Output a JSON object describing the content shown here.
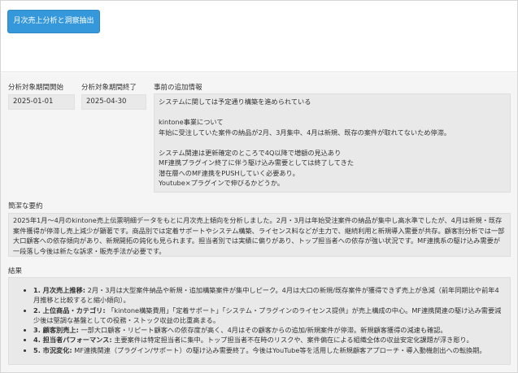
{
  "toolbar": {
    "analyze_button_label": "月次売上分析と洞察抽出"
  },
  "filters": {
    "start_label": "分析対象期間開始",
    "start_value": "2025-01-01",
    "end_label": "分析対象期間終了",
    "end_value": "2025-04-30",
    "info_label": "事前の追加情報",
    "info_lines": [
      "システムに関しては予定通り構築を進められている",
      "",
      "kintone事業について",
      "年始に受注していた案件の納品が2月、3月集中、4月は新規、既存の案件が取れてないため停滞。",
      "",
      "システム関連は更新確定のところで4Q以降で増額の見込あり",
      "MF連携プラグイン終了に伴う駆け込み需要としては終了してきた",
      "潜在層へのMF連携をPUSHしていく必要あり。",
      "Youtube×プラグインで伸びるかどうか。"
    ]
  },
  "summary": {
    "label": "簡潔な要約",
    "text": "2025年1月～4月のkintone売上伝票明細データをもとに月次売上傾向を分析しました。2月・3月は年始受注案件の納品が集中し高水準でしたが、4月は新規・既存案件獲得が停滞し売上減少が顕著です。商品別では定着サポートやシステム構築、ライセンス料などが主力で、継続利用と新規導入需要が共存。顧客別分析では一部大口顧客への依存傾向があり、新規開拓の鈍化も見られます。担当者別では実績に偏りがあり、トップ担当者への依存が強い状況です。MF連携系の駆け込み需要が一段落し今後は新たな訴求・販売手法が必要です。"
  },
  "results": {
    "label": "結果",
    "items": [
      {
        "title": "1. 月次売上推移:",
        "text": " 2月・3月は大型案件納品や新規・追加構築案件が集中しピーク。4月は大口の新規/既存案件が獲得できず売上が急減（前年同期比や前年4月推移と比較すると縮小傾向）。"
      },
      {
        "title": "2. 上位商品・カテゴリ:",
        "text": " 「kintone構築費用」「定着サポート」「システム・プラグインのライセンス提供」が売上構成の中心。MF連携関連の駆け込み需要減少後は堅調な基盤としての役務・ストック収益の比重高まる。"
      },
      {
        "title": "3. 顧客別売上:",
        "text": " 一部大口顧客・リピート顧客への依存度が高く、4月はその顧客からの追加/新規案件が停滞。新規顧客獲得の減速も確認。"
      },
      {
        "title": "4. 担当者パフォーマンス:",
        "text": " 主要案件は特定担当者に集中。トップ担当者不在時のリスクや、案件偏在による組織全体の収益安定化課題が浮き彫り。"
      },
      {
        "title": "5. 市況変化:",
        "text": " MF連携関連（プラグイン/サポート）の駆け込み需要終了。今後はYouTube等を活用した新規顧客アプローチ・導入動機創出への転換期。"
      }
    ]
  }
}
